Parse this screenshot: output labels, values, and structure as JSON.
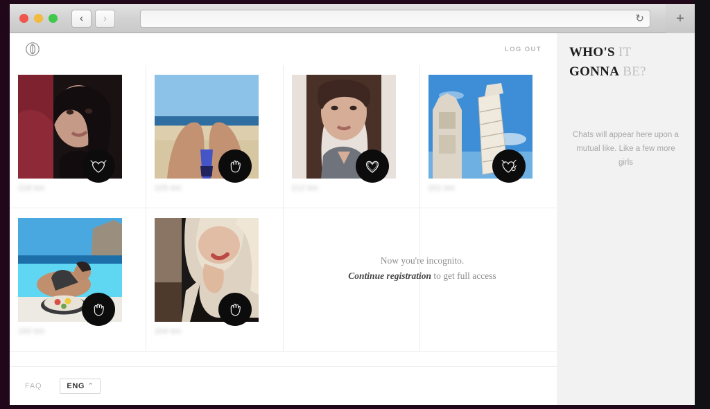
{
  "browser": {
    "traffic_lights": [
      "close",
      "minimize",
      "maximize"
    ],
    "back_icon": "‹",
    "forward_icon": "›",
    "reload_icon": "↻",
    "newtab_icon": "+",
    "url_value": "",
    "url_placeholder": ""
  },
  "app": {
    "logo_name": "eye-logo",
    "logout_label": "LOG OUT"
  },
  "notice": {
    "line1": "Now you're incognito.",
    "link": "Continue registration",
    "line2_rest": " to get full access"
  },
  "grid": {
    "rows": [
      [
        {
          "name": "profile-card-1",
          "distance": "218 km",
          "badge": "heart-devil-icon",
          "img": "portrait-red-bg"
        },
        {
          "name": "profile-card-2",
          "distance": "225 km",
          "badge": "hand-wave-icon",
          "img": "beach-legs"
        },
        {
          "name": "profile-card-3",
          "distance": "212 km",
          "badge": "heart-icon",
          "img": "portrait-selfie"
        },
        {
          "name": "profile-card-4",
          "distance": "201 km",
          "badge": "heart-devil-icon",
          "img": "pisa-tower"
        }
      ],
      [
        {
          "name": "profile-card-5",
          "distance": "193 km",
          "badge": "hand-wave-icon",
          "img": "pool-breakfast"
        },
        {
          "name": "profile-card-6",
          "distance": "204 km",
          "badge": "hand-wave-icon",
          "img": "blonde-portrait"
        }
      ]
    ]
  },
  "footer": {
    "faq_label": "FAQ",
    "language_label": "ENG",
    "language_chevron": "⌃"
  },
  "sidebar": {
    "title_strong_1": "WHO'S",
    "title_light_1": " IT",
    "title_strong_2": "GONNA",
    "title_light_2": " BE?",
    "empty_text": "Chats will appear here upon a mutual like. Like a few more girls"
  },
  "colors": {
    "page_bg": "#ffffff",
    "sidebar_bg": "#f2f2f2",
    "badge_bg": "#0c0c0c",
    "frame": "#20081a",
    "muted_text": "#a9a9a9"
  }
}
